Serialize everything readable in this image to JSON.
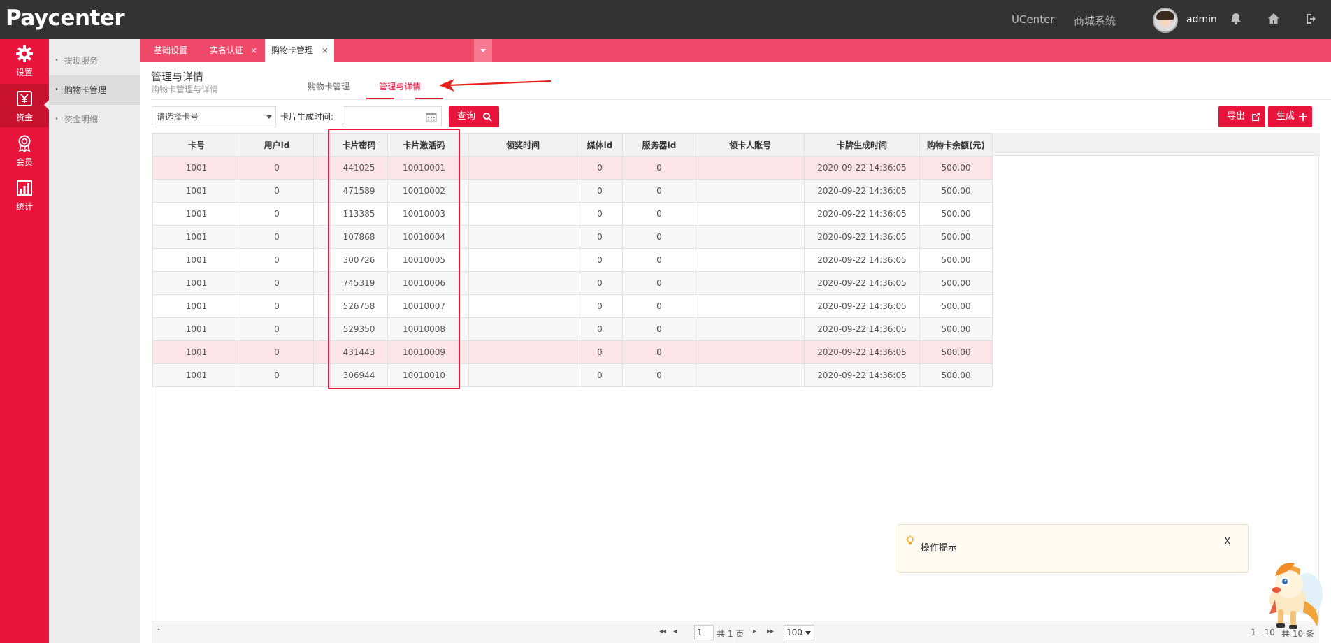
{
  "app": {
    "logo": "Paycenter",
    "top_links": [
      "UCenter",
      "商城系统"
    ],
    "username": "admin"
  },
  "sidebar": {
    "items": [
      {
        "label": "设置",
        "icon": "gear-icon"
      },
      {
        "label": "资金",
        "icon": "yen-icon"
      },
      {
        "label": "会员",
        "icon": "badge-icon"
      },
      {
        "label": "统计",
        "icon": "bar-chart-icon"
      }
    ],
    "active_index": 1
  },
  "submenu": {
    "items": [
      "提现服务",
      "购物卡管理",
      "资金明细"
    ],
    "active_index": 1
  },
  "tabs": {
    "items": [
      {
        "label": "基础设置",
        "closable": false
      },
      {
        "label": "实名认证",
        "closable": true
      },
      {
        "label": "购物卡管理",
        "closable": true
      }
    ],
    "close_glyph": "×",
    "active_index": 2
  },
  "page": {
    "title": "管理与详情",
    "subtitle": "购物卡管理与详情",
    "subtabs": [
      "购物卡管理",
      "管理与详情"
    ],
    "active_subtab": 1
  },
  "filters": {
    "card_select_placeholder": "请选择卡号",
    "date_label": "卡片生成时间:",
    "date_value": "",
    "query_button": "查询",
    "export_button": "导出",
    "generate_button": "生成"
  },
  "table": {
    "columns": [
      "卡号",
      "用户id",
      "",
      "卡片密码",
      "卡片激活码",
      "",
      "领奖时间",
      "媒体id",
      "服务器id",
      "领卡人账号",
      "卡牌生成时间",
      "购物卡余额(元)"
    ],
    "rows": [
      [
        "1001",
        "0",
        "",
        "441025",
        "10010001",
        "",
        "",
        "0",
        "0",
        "",
        "2020-09-22 14:36:05",
        "500.00"
      ],
      [
        "1001",
        "0",
        "",
        "471589",
        "10010002",
        "",
        "",
        "0",
        "0",
        "",
        "2020-09-22 14:36:05",
        "500.00"
      ],
      [
        "1001",
        "0",
        "",
        "113385",
        "10010003",
        "",
        "",
        "0",
        "0",
        "",
        "2020-09-22 14:36:05",
        "500.00"
      ],
      [
        "1001",
        "0",
        "",
        "107868",
        "10010004",
        "",
        "",
        "0",
        "0",
        "",
        "2020-09-22 14:36:05",
        "500.00"
      ],
      [
        "1001",
        "0",
        "",
        "300726",
        "10010005",
        "",
        "",
        "0",
        "0",
        "",
        "2020-09-22 14:36:05",
        "500.00"
      ],
      [
        "1001",
        "0",
        "",
        "745319",
        "10010006",
        "",
        "",
        "0",
        "0",
        "",
        "2020-09-22 14:36:05",
        "500.00"
      ],
      [
        "1001",
        "0",
        "",
        "526758",
        "10010007",
        "",
        "",
        "0",
        "0",
        "",
        "2020-09-22 14:36:05",
        "500.00"
      ],
      [
        "1001",
        "0",
        "",
        "529350",
        "10010008",
        "",
        "",
        "0",
        "0",
        "",
        "2020-09-22 14:36:05",
        "500.00"
      ],
      [
        "1001",
        "0",
        "",
        "431443",
        "10010009",
        "",
        "",
        "0",
        "0",
        "",
        "2020-09-22 14:36:05",
        "500.00"
      ],
      [
        "1001",
        "0",
        "",
        "306944",
        "10010010",
        "",
        "",
        "0",
        "0",
        "",
        "2020-09-22 14:36:05",
        "500.00"
      ]
    ],
    "highlighted_rows": [
      0,
      8
    ]
  },
  "pager": {
    "first": "◂◂",
    "prev": "◂",
    "next": "▸",
    "last": "▸▸",
    "current_page": "1",
    "total_pages_text": "共 1 页",
    "page_size": "100",
    "range_text": "1 - 10",
    "total_text": "共 10 条"
  },
  "tip": {
    "text": "操作提示",
    "close": "X"
  },
  "colors": {
    "accent": "#e8143c",
    "tabs_bar": "#f04868",
    "topbar": "#333333"
  }
}
